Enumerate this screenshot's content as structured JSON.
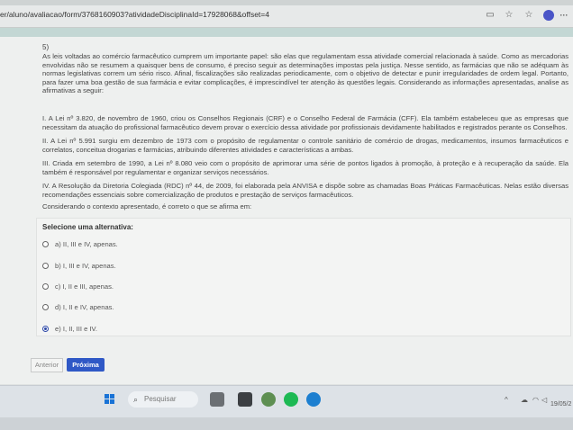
{
  "browser": {
    "url": "er/aluno/avaliacao/form/3768160903?atividadeDisciplinaId=17928068&offset=4",
    "more_label": "···"
  },
  "question": {
    "number": "5)",
    "intro": "As leis voltadas ao comércio farmacêutico cumprem um importante papel: são elas que regulamentam essa atividade comercial relacionada à saúde. Como as mercadorias envolvidas não se resumem a quaisquer bens de consumo, é preciso seguir as determinações impostas pela justiça. Nesse sentido, as farmácias que não se adéquam às normas legislativas correm um sério risco. Afinal, fiscalizações são realizadas periodicamente, com o objetivo de detectar e punir irregularidades de ordem legal. Portanto, para fazer uma boa gestão de sua farmácia e evitar complicações, é imprescindível ter atenção às questões legais. Considerando as informações apresentadas, analise as afirmativas a seguir:",
    "statements": [
      "I. A Lei nº 3.820, de novembro de 1960, criou os Conselhos Regionais (CRF) e o Conselho Federal de Farmácia (CFF). Ela também estabeleceu que as empresas que necessitam da atuação do profissional farmacêutico devem provar o exercício dessa atividade por profissionais devidamente habilitados e registrados perante os Conselhos.",
      "II. A Lei nº 5.991 surgiu em dezembro de 1973 com o propósito de regulamentar o controle sanitário de comércio de drogas, medicamentos, insumos farmacêuticos e correlatos, conceitua drogarias e farmácias, atribuindo diferentes atividades e características a ambas.",
      "III. Criada em setembro de 1990, a Lei nº 8.080 veio com o propósito de aprimorar uma série de pontos ligados à promoção, à proteção e à recuperação da saúde. Ela também é responsável por regulamentar e organizar serviços necessários.",
      "IV. A Resolução da Diretoria Colegiada (RDC) nº 44, de 2009, foi elaborada pela ANVISA e dispõe sobre as chamadas Boas Práticas Farmacêuticas. Nelas estão diversas recomendações essenciais sobre comercialização de produtos e prestação de serviços farmacêuticos."
    ],
    "prompt": "Considerando o contexto apresentado, é correto o que se afirma em:"
  },
  "answers": {
    "title": "Selecione uma alternativa:",
    "options": [
      {
        "label": "a) II, III e IV, apenas.",
        "selected": false
      },
      {
        "label": "b) I, III e IV, apenas.",
        "selected": false
      },
      {
        "label": "c) I, II e III, apenas.",
        "selected": false
      },
      {
        "label": "d) I, II e IV, apenas.",
        "selected": false
      },
      {
        "label": "e) I, II, III e IV.",
        "selected": true
      }
    ]
  },
  "nav": {
    "prev_label": "Anterior",
    "next_label": "Próxima"
  },
  "taskbar": {
    "search_placeholder": "Pesquisar",
    "date": "19/05/2"
  },
  "colors": {
    "accent": "#2f58c6",
    "band": "#c3d7d4"
  }
}
